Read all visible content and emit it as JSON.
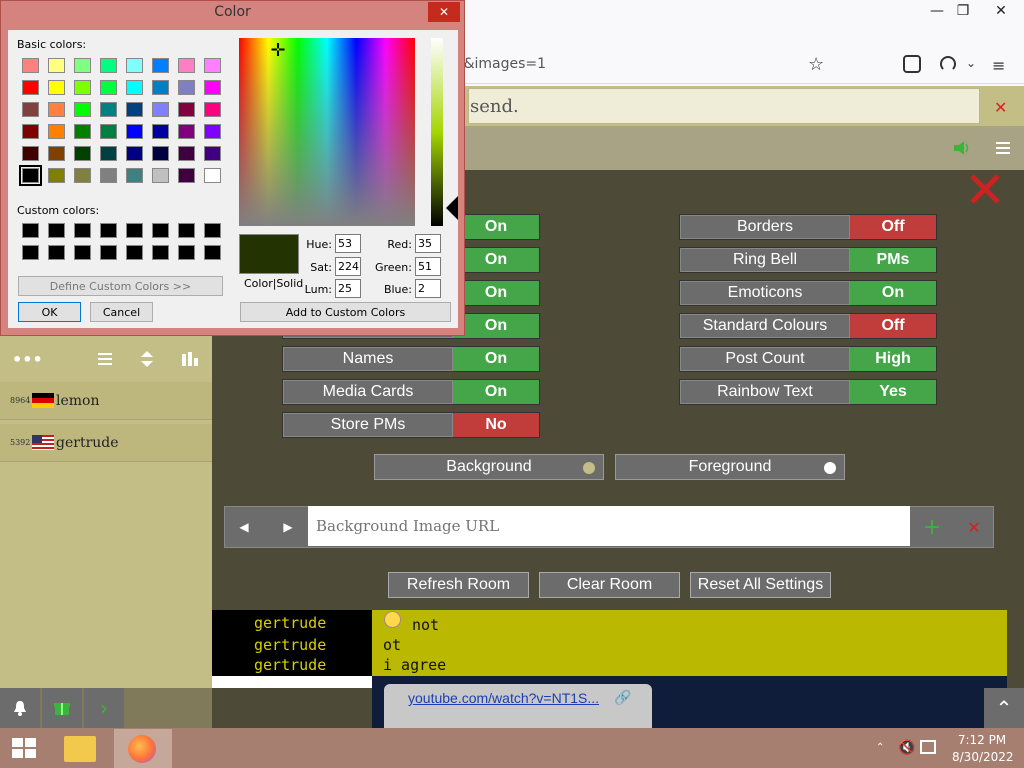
{
  "browser": {
    "url_fragment": "e&images=1",
    "window_minimize": "—",
    "window_restore": "❐",
    "window_close": "✕"
  },
  "message": {
    "text": "send.",
    "close_label": "✕"
  },
  "sidebar": {
    "users": [
      {
        "num": "8964",
        "name": "lemon",
        "flag": "de"
      },
      {
        "num": "5392",
        "name": "gertrude",
        "flag": "us"
      }
    ]
  },
  "settings": {
    "left": [
      {
        "label": "",
        "value": "On",
        "state": "on"
      },
      {
        "label": "",
        "value": "On",
        "state": "on"
      },
      {
        "label": "",
        "value": "On",
        "state": "on"
      },
      {
        "label": "",
        "value": "On",
        "state": "on"
      },
      {
        "label": "Names",
        "value": "On",
        "state": "on"
      },
      {
        "label": "Media Cards",
        "value": "On",
        "state": "on"
      },
      {
        "label": "Store PMs",
        "value": "No",
        "state": "off"
      }
    ],
    "right": [
      {
        "label": "Borders",
        "value": "Off",
        "state": "off"
      },
      {
        "label": "Ring Bell",
        "value": "PMs",
        "state": "on"
      },
      {
        "label": "Emoticons",
        "value": "On",
        "state": "on"
      },
      {
        "label": "Standard Colours",
        "value": "Off",
        "state": "off"
      },
      {
        "label": "Post Count",
        "value": "High",
        "state": "on"
      },
      {
        "label": "Rainbow Text",
        "value": "Yes",
        "state": "on"
      }
    ],
    "background_label": "Background",
    "foreground_label": "Foreground",
    "bg_url_placeholder": "Background Image URL",
    "refresh_label": "Refresh Room",
    "clear_label": "Clear Room",
    "reset_label": "Reset All Settings"
  },
  "chat": {
    "lines": [
      {
        "name": "gertrude",
        "msg": "not"
      },
      {
        "name": "gertrude",
        "msg": "ot"
      },
      {
        "name": "gertrude",
        "msg": "i agree"
      }
    ],
    "link": "youtube.com/watch?v=NT1S..."
  },
  "dialog": {
    "title": "Color",
    "basic_colors_label": "Basic colors:",
    "custom_colors_label": "Custom colors:",
    "define_custom": "Define Custom Colors >>",
    "ok": "OK",
    "cancel": "Cancel",
    "add_custom": "Add to Custom Colors",
    "color_solid": "Color|Solid",
    "hue_label": "Hue:",
    "sat_label": "Sat:",
    "lum_label": "Lum:",
    "red_label": "Red:",
    "green_label": "Green:",
    "blue_label": "Blue:",
    "hue": "53",
    "sat": "224",
    "lum": "25",
    "red": "35",
    "green": "51",
    "blue": "2",
    "basic_colors": [
      "#ff8080",
      "#ffff80",
      "#80ff80",
      "#00ff80",
      "#80ffff",
      "#0080ff",
      "#ff80c0",
      "#ff80ff",
      "#ff0000",
      "#ffff00",
      "#80ff00",
      "#00ff40",
      "#00ffff",
      "#0080c0",
      "#8080c0",
      "#ff00ff",
      "#804040",
      "#ff8040",
      "#00ff00",
      "#008080",
      "#004080",
      "#8080ff",
      "#800040",
      "#ff0080",
      "#800000",
      "#ff8000",
      "#008000",
      "#008040",
      "#0000ff",
      "#0000a0",
      "#800080",
      "#8000ff",
      "#400000",
      "#804000",
      "#004000",
      "#004040",
      "#000080",
      "#000040",
      "#400040",
      "#400080",
      "#000000",
      "#808000",
      "#808040",
      "#808080",
      "#408080",
      "#c0c0c0",
      "#400040",
      "#ffffff"
    ],
    "selected_color": "#233302"
  },
  "taskbar": {
    "time": "7:12 PM",
    "date": "8/30/2022"
  }
}
